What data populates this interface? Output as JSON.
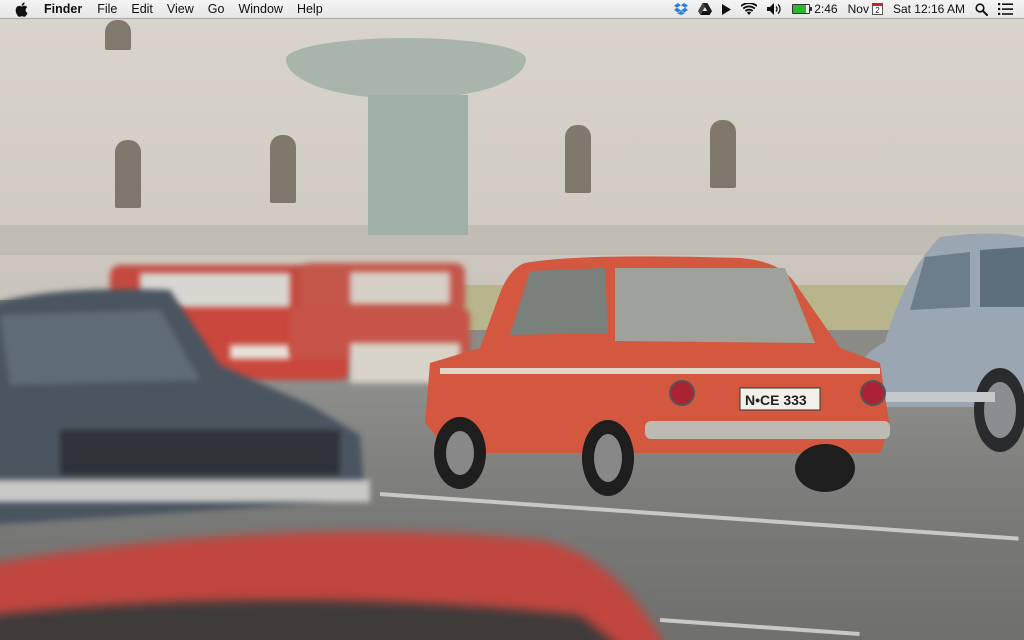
{
  "menubar": {
    "apple_icon": "apple-icon",
    "app_name": "Finder",
    "menus": [
      "File",
      "Edit",
      "View",
      "Go",
      "Window",
      "Help"
    ]
  },
  "status": {
    "icons": [
      "dropbox-icon",
      "google-drive-icon",
      "play-icon",
      "wifi-icon",
      "volume-icon",
      "battery-icon"
    ],
    "battery_time": "2:46",
    "battery_level_fraction": 0.8,
    "calendar_month": "Nov",
    "calendar_day": "2",
    "clock": "Sat 12:16 AM",
    "spotlight_icon": "spotlight-icon",
    "notification_center_icon": "notification-center-icon"
  },
  "wallpaper": {
    "license_plate": "N•CE 333",
    "colors": {
      "orange_car": "#d4573f",
      "red_car": "#c94a40",
      "blue_car": "#4a5560",
      "vw_beetle": "#9aa8b4"
    }
  }
}
